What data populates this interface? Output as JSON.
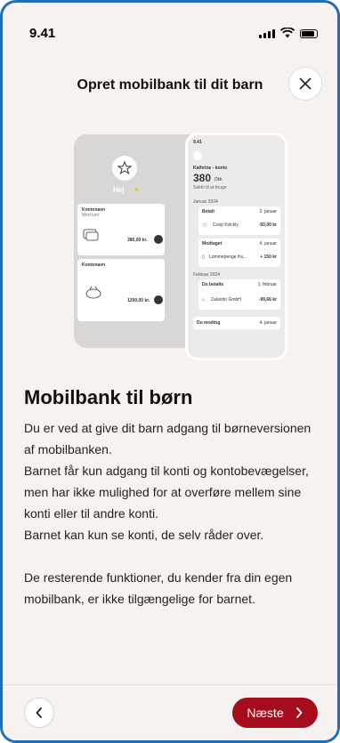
{
  "status_bar": {
    "time": "9.41"
  },
  "header": {
    "title": "Opret mobilbank til dit barn"
  },
  "illustration": {
    "left_phone": {
      "greeting": "Hej",
      "card1_title": "Kontonavn",
      "card1_sub": "Med kort",
      "card1_amount": "380,00 kr.",
      "card2_title": "Kontonavn",
      "card2_amount": "1290,00 kr."
    },
    "right_phone": {
      "time": "9.41",
      "account_title": "Kathrine - konto",
      "balance": "380",
      "currency": "Dkk",
      "balance_note": "Saldo til at bruge",
      "month1": "Januar 2024",
      "tx1_label": "Betalt",
      "tx1_date": "2. januar",
      "tx1_name": "Coop Kvickly",
      "tx1_amount": "-50,00 kr",
      "tx2_label": "Modtaget",
      "tx2_date": "4. januar",
      "tx2_name": "Lommepenge fra...",
      "tx2_amount": "+ 150 kr",
      "month2": "Februar 2024",
      "tx3_label": "Du betalte",
      "tx3_date": "1. februar",
      "tx3_name": "Zalando GmbH",
      "tx3_amount": "-99,66 kr",
      "tx4_label": "Du modtog",
      "tx4_date": "4. januar"
    }
  },
  "content": {
    "heading": "Mobilbank til børn",
    "paragraph1": "Du er ved at give dit barn adgang til børneversionen af mobilbanken.",
    "paragraph2": "Barnet får kun adgang til konti og kontobevægelser, men har ikke mulighed for at overføre mellem sine konti eller til andre konti.",
    "paragraph3": "Barnet kan kun se konti, de selv råder over.",
    "paragraph4": "De resterende funktioner, du kender fra din egen mobilbank, er ikke tilgængelige for barnet."
  },
  "footer": {
    "next_label": "Næste"
  },
  "colors": {
    "accent": "#a50d1c",
    "background": "#f5f2ef",
    "frame": "#1f6fb7"
  },
  "icons": {
    "close": "close-icon",
    "back": "chevron-left-icon",
    "next": "chevron-right-icon"
  }
}
